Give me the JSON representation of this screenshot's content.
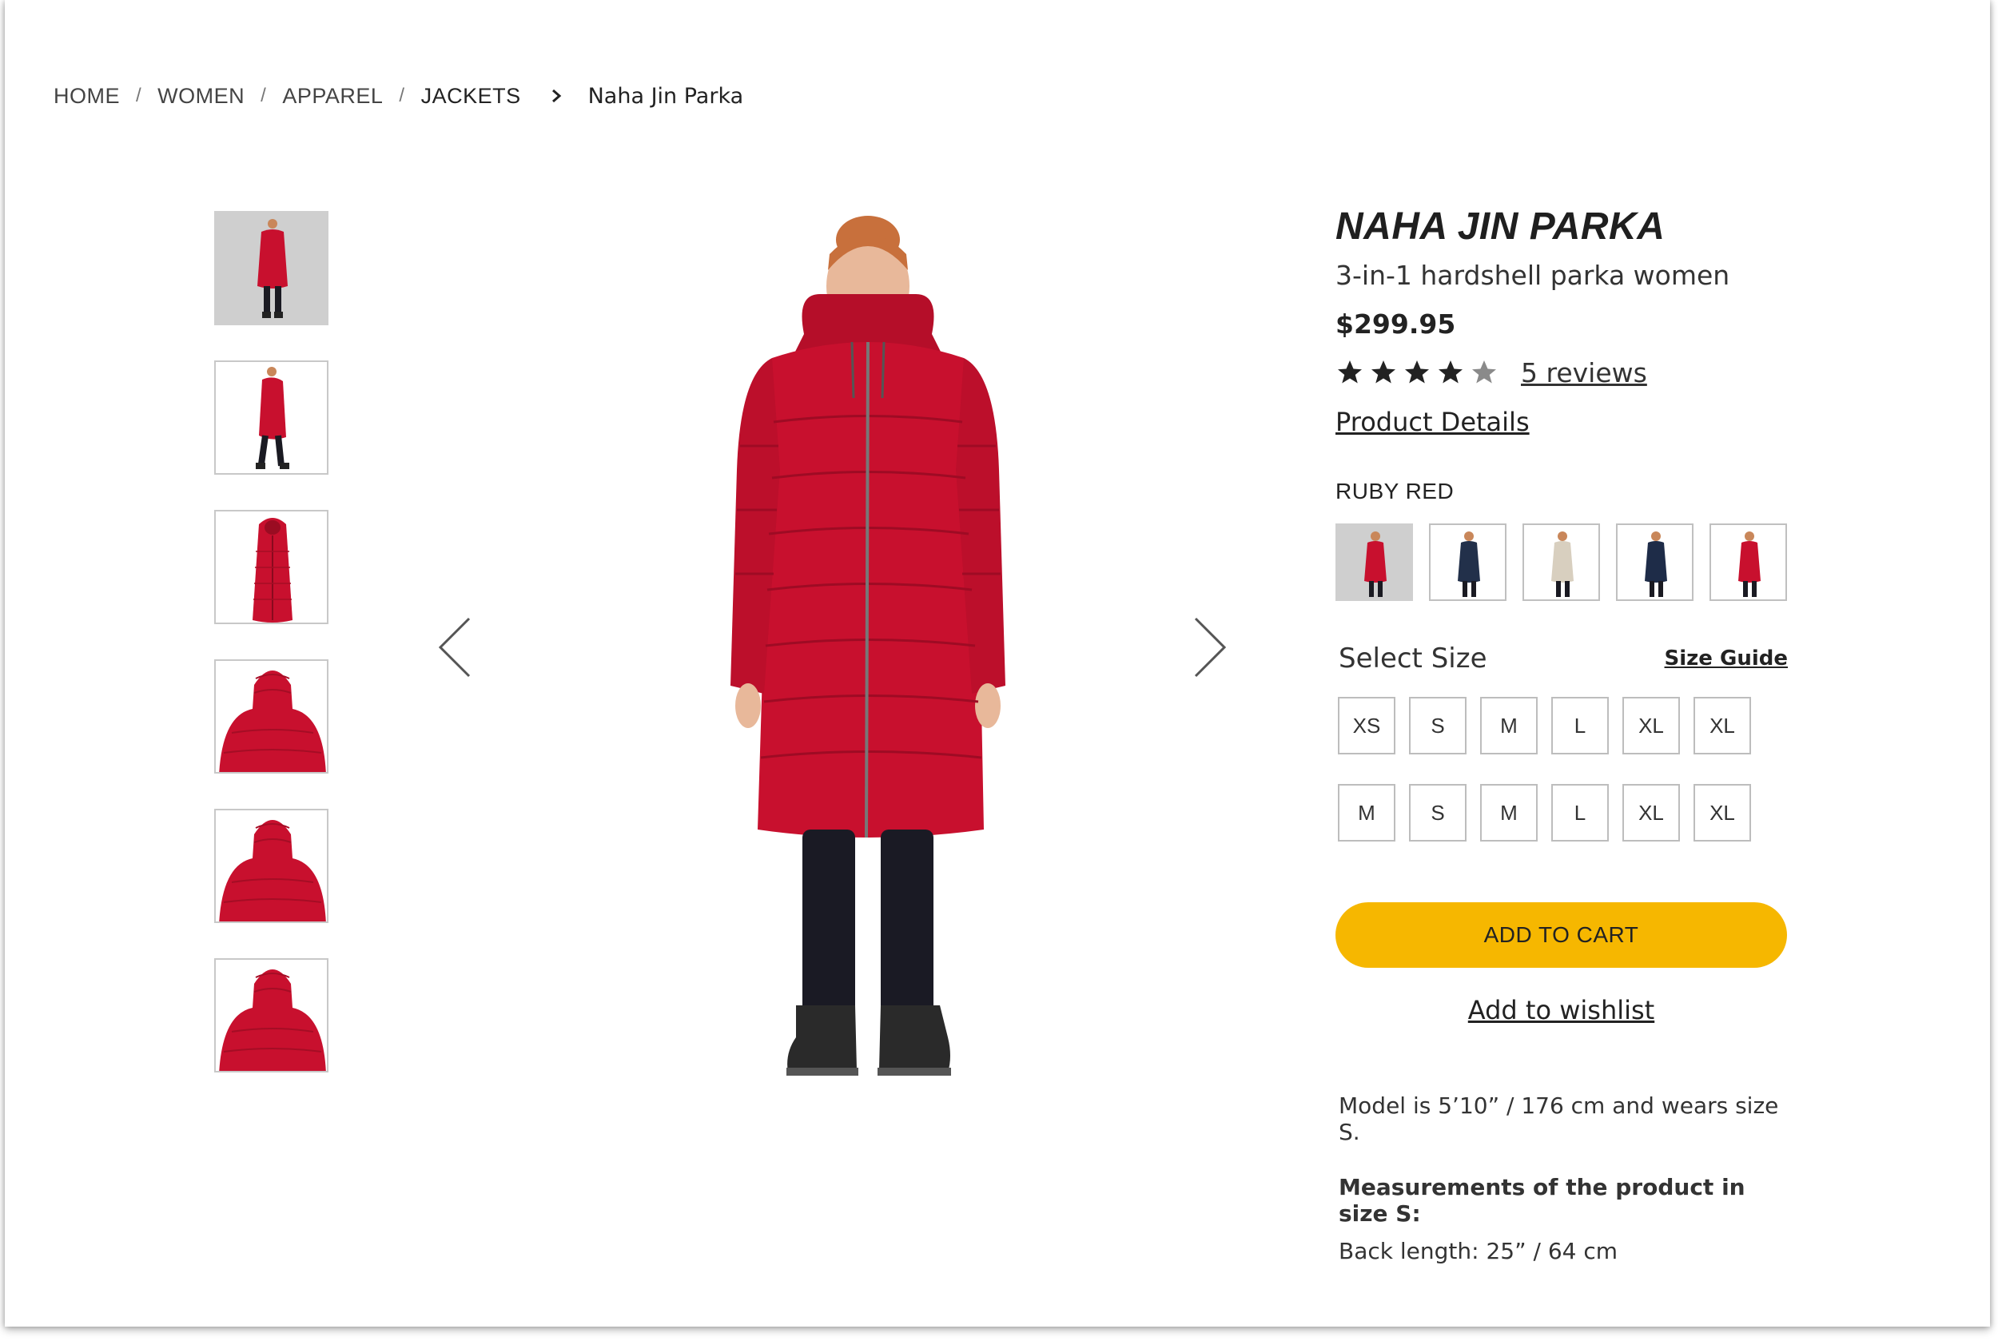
{
  "breadcrumb": {
    "items": [
      "HOME",
      "WOMEN",
      "APPAREL",
      "JACKETS"
    ],
    "separator": "/",
    "current": "Naha Jin Parka"
  },
  "gallery": {
    "thumbnails": [
      "front view",
      "side view",
      "hood front view",
      "back view 1",
      "back view 2",
      "back view 3"
    ],
    "prev_icon": "chevron-left-icon",
    "next_icon": "chevron-right-icon"
  },
  "product": {
    "title": "NAHA JIN PARKA",
    "subtitle": "3-in-1 hardshell parka women",
    "price": "$299.95",
    "rating": 4,
    "rating_max": 5,
    "reviews_label": "5 reviews",
    "details_label": "Product Details"
  },
  "color": {
    "selected_name": "RUBY RED",
    "swatches": [
      {
        "name": "ruby-red",
        "hex": "#c8102e"
      },
      {
        "name": "navy",
        "hex": "#22304a"
      },
      {
        "name": "beige",
        "hex": "#d8cfbf"
      },
      {
        "name": "dark-blue",
        "hex": "#1e2c48"
      },
      {
        "name": "red",
        "hex": "#c8102e"
      }
    ]
  },
  "size": {
    "label": "Select Size",
    "guide_label": "Size Guide",
    "options": [
      "XS",
      "S",
      "M",
      "L",
      "XL",
      "XL",
      "M",
      "S",
      "M",
      "L",
      "XL",
      "XL"
    ]
  },
  "actions": {
    "add_to_cart": "ADD TO CART",
    "add_to_wishlist": "Add to wishlist"
  },
  "info": {
    "model": "Model is 5’10” / 176 cm and wears size S.",
    "measurements_title": "Measurements of the product in size S:",
    "measurements_value": "Back length: 25” / 64 cm"
  },
  "colors": {
    "accent": "#f6b700",
    "jacket": "#c8102e",
    "text": "#2b2b2b",
    "border": "#bdbdbd"
  }
}
